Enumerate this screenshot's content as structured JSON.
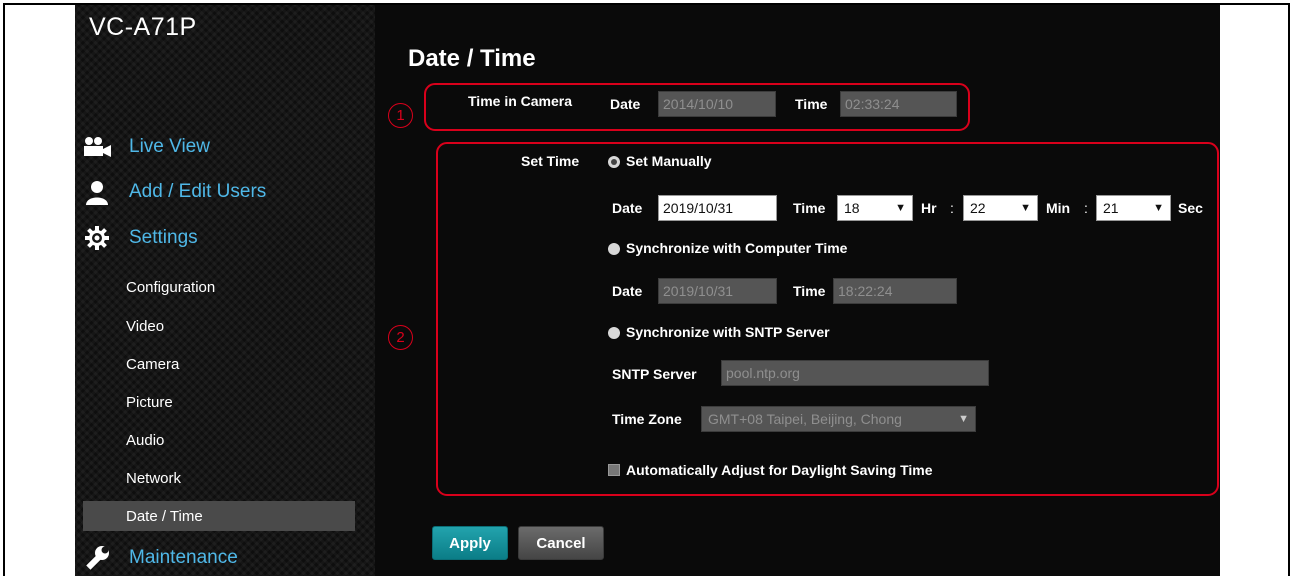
{
  "app": {
    "title": "VC-A71P"
  },
  "nav": {
    "live_view": "Live View",
    "add_edit_users": "Add / Edit Users",
    "settings": "Settings",
    "sub": [
      "Configuration",
      "Video",
      "Camera",
      "Picture",
      "Audio",
      "Network",
      "Date / Time"
    ],
    "active_sub": "Date / Time",
    "maintenance": "Maintenance"
  },
  "page": {
    "title": "Date / Time",
    "markers": [
      "1",
      "2"
    ],
    "time_in_camera": {
      "label": "Time in Camera",
      "date_label": "Date",
      "date_value": "2014/10/10",
      "time_label": "Time",
      "time_value": "02:33:24"
    },
    "set_time": {
      "label": "Set Time",
      "manual": {
        "label": "Set Manually",
        "selected": true,
        "date_label": "Date",
        "date_value": "2019/10/31",
        "time_label": "Time",
        "hour": "18",
        "hr_label": "Hr",
        "minute": "22",
        "min_label": "Min",
        "second": "21",
        "sec_label": "Sec",
        "colon": ":"
      },
      "computer": {
        "label": "Synchronize with Computer Time",
        "date_label": "Date",
        "date_value": "2019/10/31",
        "time_label": "Time",
        "time_value": "18:22:24"
      },
      "sntp": {
        "label": "Synchronize with SNTP Server",
        "server_label": "SNTP Server",
        "server_value": "pool.ntp.org",
        "timezone_label": "Time Zone",
        "timezone_value": "GMT+08 Taipei, Beijing, Chong"
      },
      "dst_label": "Automatically Adjust for Daylight Saving Time"
    },
    "buttons": {
      "apply": "Apply",
      "cancel": "Cancel"
    }
  },
  "colors": {
    "accent": "#4fb8e8",
    "marker": "#d9001b",
    "apply": "#0b7d87"
  }
}
